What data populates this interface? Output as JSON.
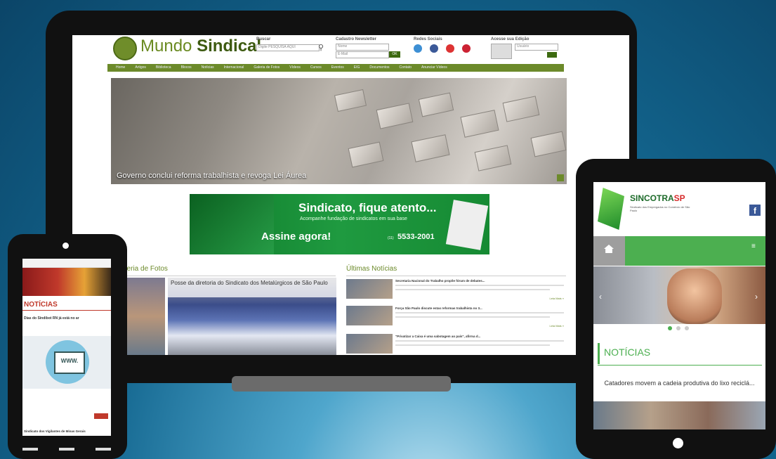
{
  "site": {
    "logo_light": "Mundo ",
    "logo_bold": "Sindical",
    "search_label": "Buscar",
    "search_placeholder": "Digite PESQUISA AQUI",
    "newsletter_label": "Cadastro Newsletter",
    "newsletter_name": "Nome",
    "newsletter_email": "E-Mail",
    "newsletter_ok": "OK",
    "social_label": "Redes Sociais",
    "edition_label": "Acesse sua Edição",
    "edition_user": "Usuário",
    "nav": [
      "Home",
      "Artigos",
      "Biblioteca",
      "Blocos",
      "Notícias",
      "Internacional",
      "Galeria de Fotos",
      "Vídeos",
      "Cursos",
      "Eventos",
      "EIG",
      "Documentos",
      "Contato",
      "Anunciar Vídeos"
    ],
    "hero_caption": "Governo conclui reforma trabalhista e revoga Lei Áurea",
    "banner_title": "Sindicato, fique atento...",
    "banner_sub": "Acompanhe fundação de sindicatos em sua base",
    "banner_cta": "Assine agora!",
    "banner_phone": "5533-2001",
    "banner_phone_prefix": "(11)",
    "gallery_title": "Galeria de Fotos",
    "gallery_caption": "Posse da diretoria do Sindicato dos Metalúrgicos de São Paulo",
    "news_title": "Últimas Notícias",
    "news": [
      {
        "title": "Secretaria Nacional do Trabalho propõe fórum de debates..."
      },
      {
        "title": "Força São Paulo discute estas reformas trabalhista no 3..."
      },
      {
        "title": "\"Privatizar a Caixa é uma sabotagem ao país\", afirma d..."
      }
    ],
    "leia_mais": "Leia Mais »"
  },
  "phone": {
    "noticias": "NOTÍCIAS",
    "headline": "Dias do Sindibot RN já está no ar",
    "www": "WWW.",
    "footer_headline": "Sindicato dos Vigilantes de Minas Gerais"
  },
  "tablet": {
    "brand": "SINCOTRA",
    "brand_sp": "SP",
    "brand_sub": "Sindicato dos Empregados no Comércio de São Paulo",
    "noticias": "NOTÍCIAS",
    "headline": "Catadores movem a cadeia produtiva do lixo reciclá..."
  },
  "colors": {
    "site_green": "#6c8a2a",
    "tablet_green": "#4caf50",
    "phone_red": "#c0392b"
  }
}
